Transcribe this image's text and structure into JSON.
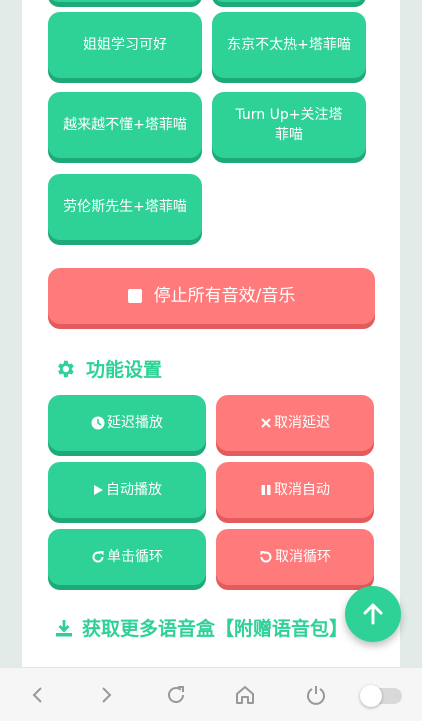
{
  "sound_buttons": [
    {
      "label": "姐姐学习可好"
    },
    {
      "label": "东京不太热+塔菲喵"
    },
    {
      "label": "越来越不懂+塔菲喵"
    },
    {
      "label": "Turn Up+关注塔菲喵"
    },
    {
      "label": "劳伦斯先生+塔菲喵"
    }
  ],
  "stop_all": {
    "label": "停止所有音效/音乐"
  },
  "features": {
    "title": "功能设置",
    "delay_play": "延迟播放",
    "cancel_delay": "取消延迟",
    "auto_play": "自动播放",
    "cancel_auto": "取消自动",
    "single_loop": "单击循环",
    "cancel_loop": "取消循环"
  },
  "download": {
    "title": "获取更多语音盒【附赠语音包】"
  },
  "colors": {
    "green": "#2ed196",
    "red": "#ff7b7b",
    "page_bg": "#e2ebe8"
  }
}
